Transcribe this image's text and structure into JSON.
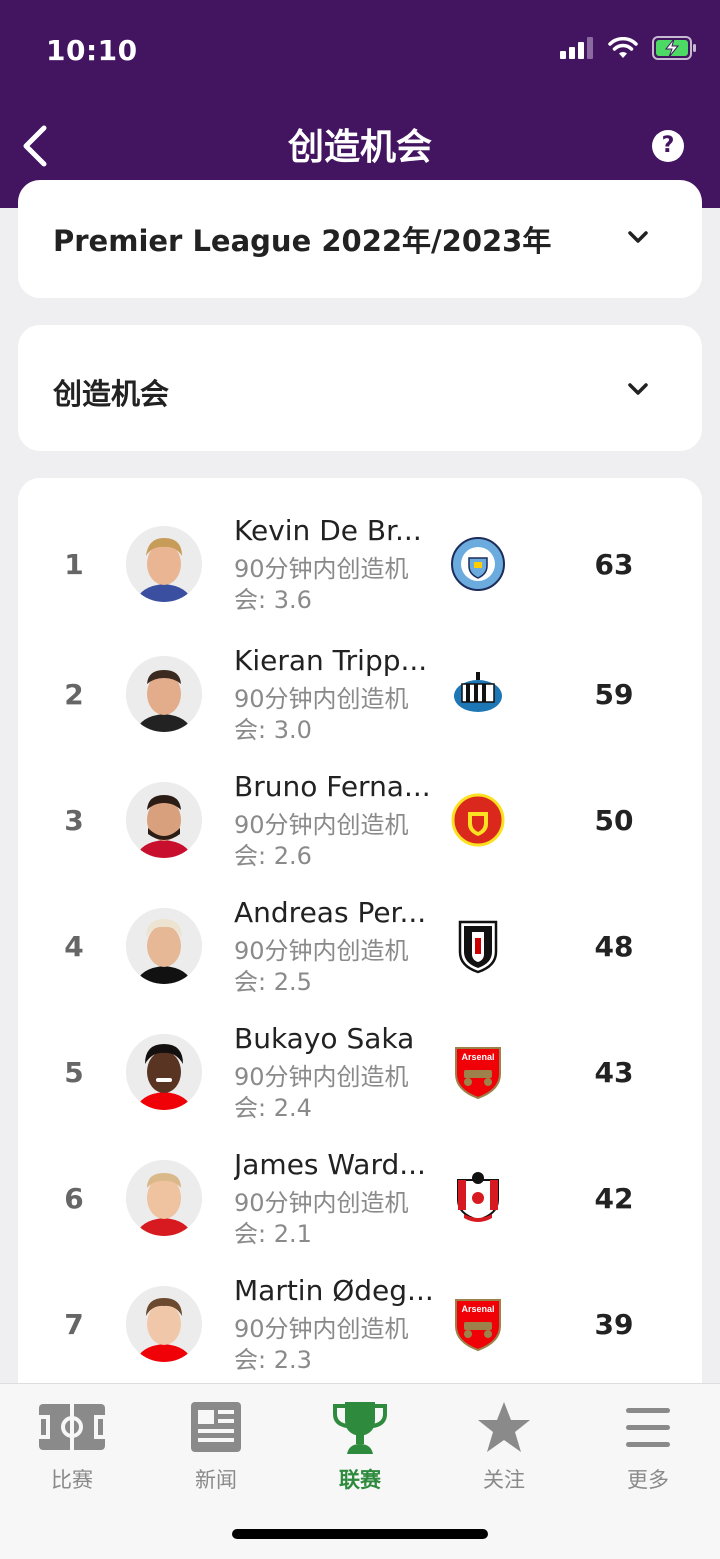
{
  "status_bar": {
    "time": "10:10"
  },
  "header": {
    "title": "创造机会",
    "help": "?"
  },
  "season_select": {
    "label": "Premier League 2022年/2023年"
  },
  "stat_select": {
    "label": "创造机会"
  },
  "colors": {
    "header_bg": "#431460",
    "active_tab": "#2e8b3e"
  },
  "players": [
    {
      "rank": "1",
      "name": "Kevin De Br...",
      "sub": "90分钟内创造机会: 3.6",
      "club_icon": "manchester-city-crest",
      "value": "63"
    },
    {
      "rank": "2",
      "name": "Kieran Tripp...",
      "sub": "90分钟内创造机会: 3.0",
      "club_icon": "newcastle-united-crest",
      "value": "59"
    },
    {
      "rank": "3",
      "name": "Bruno Ferna...",
      "sub": "90分钟内创造机会: 2.6",
      "club_icon": "manchester-united-crest",
      "value": "50"
    },
    {
      "rank": "4",
      "name": "Andreas Per...",
      "sub": "90分钟内创造机会: 2.5",
      "club_icon": "fulham-crest",
      "value": "48"
    },
    {
      "rank": "5",
      "name": "Bukayo Saka",
      "sub": "90分钟内创造机会: 2.4",
      "club_icon": "arsenal-crest",
      "value": "43"
    },
    {
      "rank": "6",
      "name": "James Ward...",
      "sub": "90分钟内创造机会: 2.1",
      "club_icon": "southampton-crest",
      "value": "42"
    },
    {
      "rank": "7",
      "name": "Martin Ødeg...",
      "sub": "90分钟内创造机会: 2.3",
      "club_icon": "arsenal-crest",
      "value": "39"
    }
  ],
  "tabs": [
    {
      "label": "比赛",
      "icon": "pitch-icon"
    },
    {
      "label": "新闻",
      "icon": "news-icon"
    },
    {
      "label": "联赛",
      "icon": "trophy-icon"
    },
    {
      "label": "关注",
      "icon": "star-icon"
    },
    {
      "label": "更多",
      "icon": "menu-icon"
    }
  ]
}
